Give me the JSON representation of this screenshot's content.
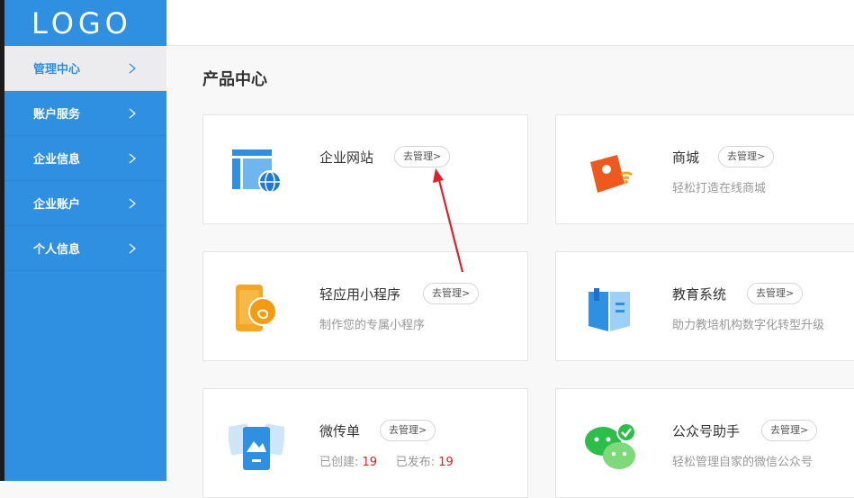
{
  "logo": "LOGO",
  "sidebar": {
    "items": [
      {
        "label": "管理中心"
      },
      {
        "label": "账户服务"
      },
      {
        "label": "企业信息"
      },
      {
        "label": "企业账户"
      },
      {
        "label": "个人信息"
      }
    ]
  },
  "main": {
    "title": "产品中心",
    "cards": [
      {
        "name": "企业网站",
        "manage": "去管理>",
        "desc": ""
      },
      {
        "name": "商城",
        "manage": "去管理>",
        "desc": "轻松打造在线商城"
      },
      {
        "name": "轻应用小程序",
        "manage": "去管理>",
        "desc": "制作您的专属小程序"
      },
      {
        "name": "教育系统",
        "manage": "去管理>",
        "desc": "助力教培机构数字化转型升级"
      },
      {
        "name": "微传单",
        "manage": "去管理>",
        "created_label": "已创建:",
        "created_value": "19",
        "published_label": "已发布:",
        "published_value": "19"
      },
      {
        "name": "公众号助手",
        "manage": "去管理>",
        "desc": "轻松管理自家的微信公众号"
      }
    ]
  },
  "colors": {
    "sidebar": "#2f8fe0",
    "accent_red": "#e02020"
  }
}
